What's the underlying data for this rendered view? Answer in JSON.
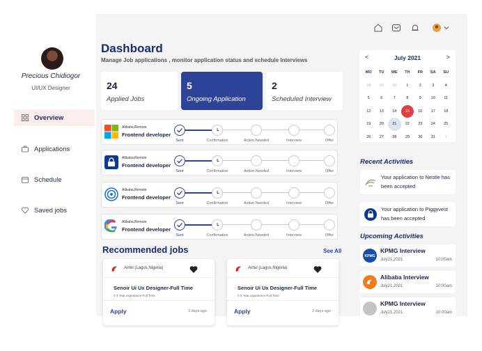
{
  "user": {
    "name": "Precious Chidiogor",
    "role": "UI/UX Designer"
  },
  "nav": [
    {
      "label": "Overview",
      "icon": "grid-icon"
    },
    {
      "label": "Applications",
      "icon": "briefcase-icon"
    },
    {
      "label": "Schedule",
      "icon": "calendar-icon"
    },
    {
      "label": "Saved jobs",
      "icon": "heart-icon"
    }
  ],
  "header": {
    "title": "Dashboard",
    "subtitle": "Manage Job applications , monitor application status and schedule Interviews"
  },
  "stats": [
    {
      "value": "24",
      "label": "Applied Jobs"
    },
    {
      "value": "5",
      "label": "Ongoing Application"
    },
    {
      "value": "2",
      "label": "Scheduled Interview"
    }
  ],
  "stages": [
    "Sent",
    "Confirmation",
    "Action Needed",
    "Interview",
    "Offer"
  ],
  "applications": [
    {
      "company": "Alibaba,Remote",
      "title": "Frontend developer",
      "logo": "microsoft-logo-icon"
    },
    {
      "company": "Alibaba,Remote",
      "title": "Frontend developer",
      "logo": "piggyvest-logo-icon"
    },
    {
      "company": "Alibaba,Remote",
      "title": "Frontend developer",
      "logo": "target-logo-icon"
    },
    {
      "company": "Alibaba,Remote",
      "title": "Frontend developer",
      "logo": "google-logo-icon"
    }
  ],
  "recommended": {
    "title": "Recommended jobs",
    "see_all": "See All",
    "jobs": [
      {
        "company": "Airtel (Lagos,Nigeria)",
        "title": "Senoir Ui Ux Designer-Full Time",
        "experience": "2-3 Year experience-Full Time",
        "apply": "Apply",
        "posted": "3 days ago"
      },
      {
        "company": "Airtel (Lagos,Nigeria)",
        "title": "Senoir Ui Ux Designer-Full Time",
        "experience": "2-3 Year experience-Full Time",
        "apply": "Apply",
        "posted": "3 days ago"
      }
    ]
  },
  "calendar": {
    "month": "July 2021",
    "weekdays": [
      "MO",
      "TU",
      "WE",
      "TH",
      "FR",
      "SA",
      "SU"
    ],
    "days": [
      "28",
      "29",
      "30",
      "1",
      "2",
      "3",
      "4",
      "5",
      "6",
      "7",
      "8",
      "9",
      "10",
      "11",
      "12",
      "13",
      "14",
      "15",
      "16",
      "17",
      "18",
      "19",
      "20",
      "21",
      "22",
      "23",
      "24",
      "25",
      "26",
      "27",
      "28",
      "29",
      "30",
      "31",
      "1"
    ],
    "today": "15",
    "selected": "21"
  },
  "recent_activities": {
    "title": "Recent Activities",
    "items": [
      {
        "text": "Your application to Nestle has been accepted",
        "icon": "nestle-logo-icon"
      },
      {
        "text": "Your application to Piggyvest has been accepted",
        "icon": "piggyvest-logo-icon"
      }
    ]
  },
  "upcoming": {
    "title": "Upcoming Activities",
    "items": [
      {
        "title": "KPMG Interview",
        "date": "July21,2021",
        "time": "10:00am",
        "color": "#1c4aa8"
      },
      {
        "title": "Alibaba Interview",
        "date": "July21,2021",
        "time": "10:00am",
        "color": "#f07c1a"
      },
      {
        "title": "KPMG Interview",
        "date": "July21,2021",
        "time": "10:00am",
        "color": "#c4c4c4"
      }
    ]
  },
  "colors": {
    "primary": "#2d4397",
    "accent": "#e24040",
    "background": "#f4f4f4"
  }
}
